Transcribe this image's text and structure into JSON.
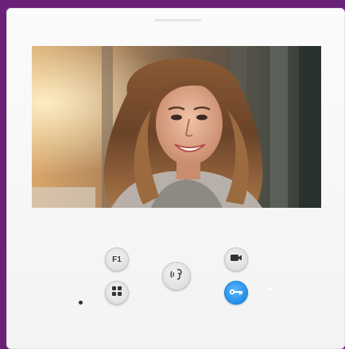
{
  "device": {
    "screen": {
      "content": "video feed"
    },
    "buttons": {
      "f1": {
        "label": "F1",
        "icon": "f1-icon"
      },
      "menu": {
        "icon": "grid-icon"
      },
      "talk": {
        "icon": "speech-icon"
      },
      "camera": {
        "icon": "video-camera-icon"
      },
      "door_open": {
        "icon": "key-icon"
      }
    },
    "colors": {
      "frame": "#6a2278",
      "panel": "#f6f6f6",
      "button": "#e3e3e3",
      "door_button": "#1d8de8"
    }
  }
}
